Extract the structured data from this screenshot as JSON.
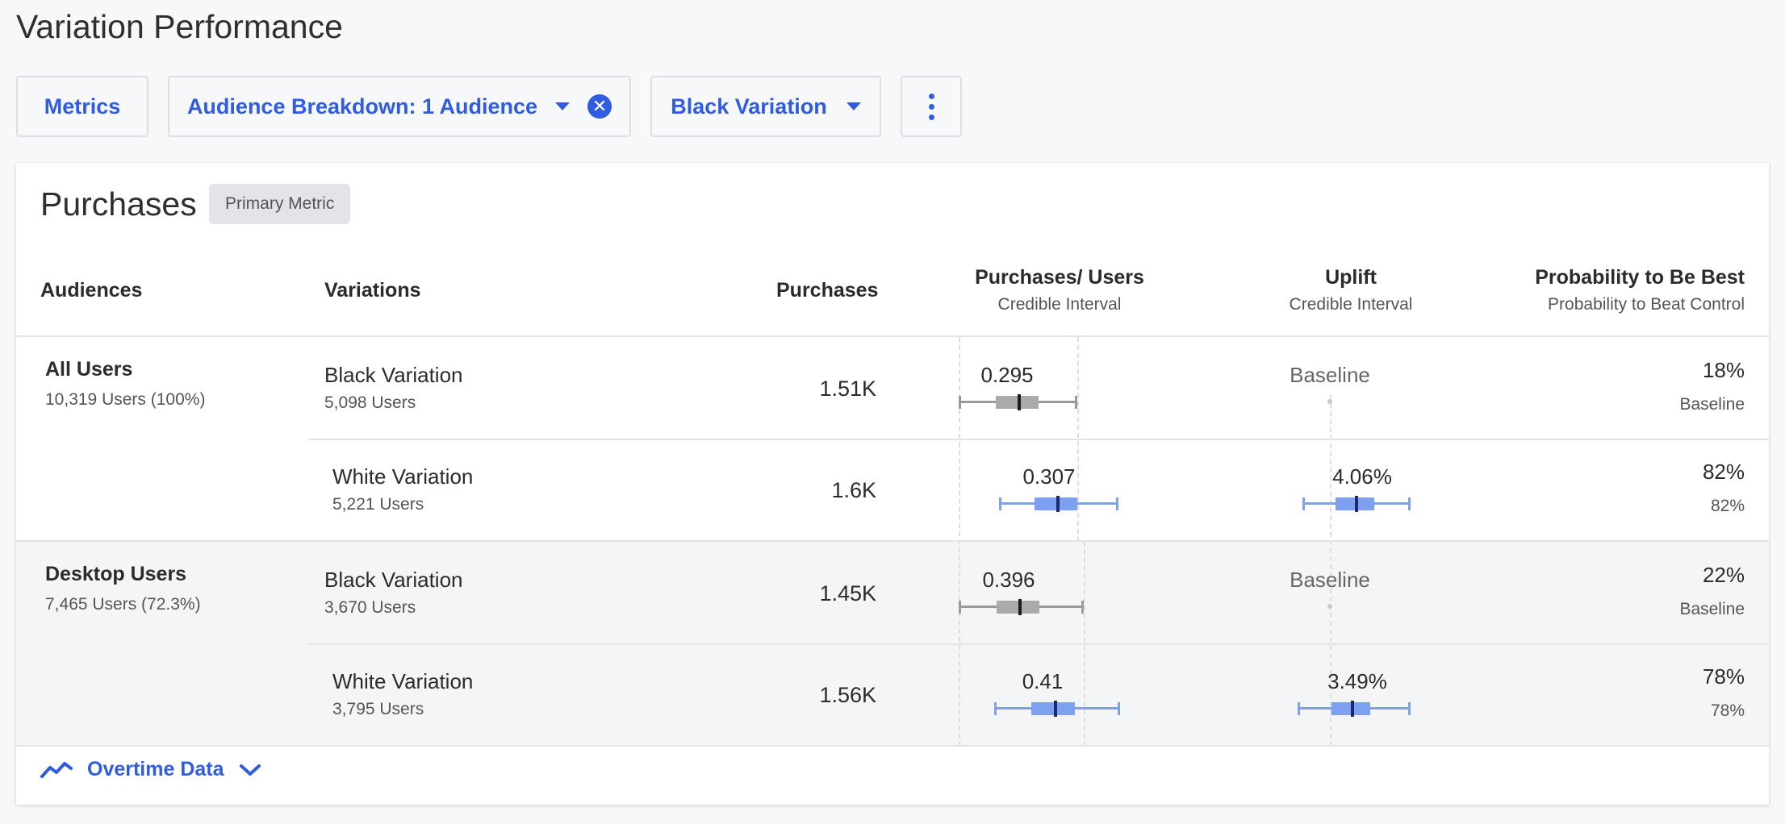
{
  "page": {
    "title": "Variation Performance"
  },
  "toolbar": {
    "metrics_label": "Metrics",
    "audience_label": "Audience Breakdown: 1 Audience",
    "variation_label": "Black Variation"
  },
  "card": {
    "title": "Purchases",
    "badge": "Primary Metric",
    "columns": {
      "audiences": "Audiences",
      "variations": "Variations",
      "purchases": "Purchases",
      "rate": "Purchases/ Users",
      "rate_sub": "Credible Interval",
      "uplift": "Uplift",
      "uplift_sub": "Credible Interval",
      "prob": "Probability to Be Best",
      "prob_sub": "Probability to Beat Control"
    },
    "groups": [
      {
        "audience": "All Users",
        "count": "10,319 Users (100%)",
        "rows": [
          {
            "variation": "Black Variation",
            "users": "5,098 Users",
            "purchases": "1.51K",
            "rate": "0.295",
            "uplift": "Baseline",
            "prob": "18%",
            "prob_sub": "Baseline"
          },
          {
            "variation": "White Variation",
            "users": "5,221 Users",
            "purchases": "1.6K",
            "rate": "0.307",
            "uplift": "4.06%",
            "prob": "82%",
            "prob_sub": "82%"
          }
        ]
      },
      {
        "audience": "Desktop Users",
        "count": "7,465 Users (72.3%)",
        "rows": [
          {
            "variation": "Black Variation",
            "users": "3,670 Users",
            "purchases": "1.45K",
            "rate": "0.396",
            "uplift": "Baseline",
            "prob": "22%",
            "prob_sub": "Baseline"
          },
          {
            "variation": "White Variation",
            "users": "3,795 Users",
            "purchases": "1.56K",
            "rate": "0.41",
            "uplift": "3.49%",
            "prob": "78%",
            "prob_sub": "78%"
          }
        ]
      }
    ],
    "footer_label": "Overtime Data"
  },
  "colors": {
    "accent": "#2f5ce0",
    "interval_blue": "#7ea0f0",
    "interval_gray": "#aaaaaa"
  },
  "icons": [
    "caret-down-icon",
    "close-circle-icon",
    "kebab-menu-icon",
    "trend-line-icon",
    "chevron-down-icon"
  ]
}
